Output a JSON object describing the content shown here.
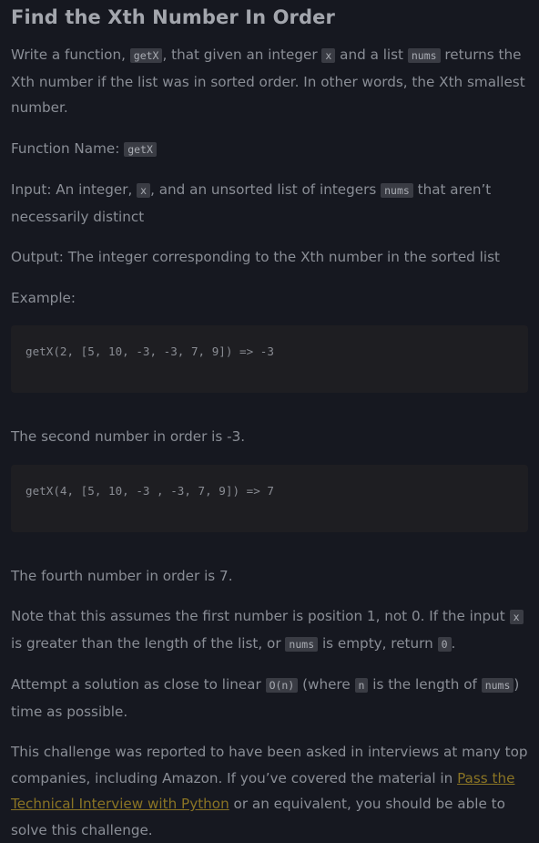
{
  "title": "Find the Xth Number In Order",
  "intro": {
    "t1": "Write a function, ",
    "c1": "getX",
    "t2": ", that given an integer ",
    "c2": "x",
    "t3": " and a list ",
    "c3": "nums",
    "t4": " returns the Xth number if the list was in sorted order. In other words, the Xth smallest number."
  },
  "function_name": {
    "label": "Function Name: ",
    "code": "getX"
  },
  "input": {
    "t1": "Input: An integer, ",
    "c1": "x",
    "t2": ", and an unsorted list of integers ",
    "c2": "nums",
    "t3": " that aren’t necessarily distinct"
  },
  "output": "Output: The integer corresponding to the Xth number in the sorted list",
  "example_label": "Example:",
  "example1": {
    "code": "getX(2, [5, 10, -3, -3, 7, 9]) => -3",
    "explanation": "The second number in order is -3."
  },
  "example2": {
    "code": "getX(4, [5, 10, -3 , -3, 7, 9]) => 7",
    "explanation": "The fourth number in order is 7."
  },
  "note": {
    "t1": "Note that this assumes the first number is position 1, not 0. If the input ",
    "c1": "x",
    "t2": " is greater than the length of the list, or ",
    "c2": "nums",
    "t3": " is empty, return ",
    "c3": "0",
    "t4": "."
  },
  "attempt": {
    "t1": "Attempt a solution as close to linear ",
    "c1": "O(n)",
    "t2": " (where ",
    "c2": "n",
    "t3": " is the length of ",
    "c3": "nums",
    "t4": ") time as possible."
  },
  "closing": {
    "t1": "This challenge was reported to have been asked in interviews at many top companies, including Amazon. If you’ve covered the material in ",
    "link": "Pass the Technical Interview with Python",
    "t2": " or an equivalent, you should be able to solve this challenge."
  },
  "colors": {
    "background": "#161820",
    "text": "#8a8e96",
    "heading": "#a3a6ad",
    "code_bg": "#1e1e22",
    "inline_code_bg": "#3a3c44",
    "link": "#8a7424"
  }
}
